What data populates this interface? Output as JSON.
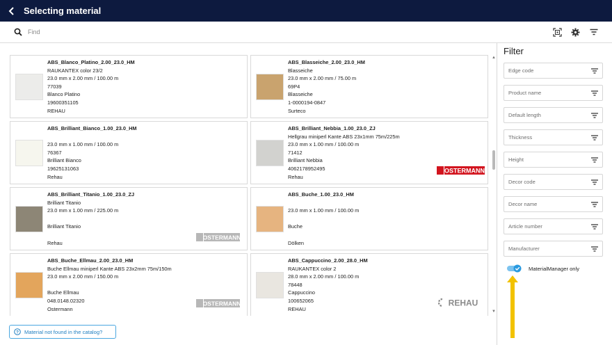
{
  "header": {
    "title": "Selecting material"
  },
  "search": {
    "placeholder": "Find"
  },
  "toolbar_icons": [
    "barcode-scan-icon",
    "gear-icon",
    "filter-lines-icon"
  ],
  "cards": [
    {
      "name": "ABS_Blanco_Platino_2.00_23.0_HM",
      "lines": [
        "RAUKANTEX color 23/2",
        "23.0 mm x 2.00 mm / 100.00 m",
        "77039",
        "Blanco Platino",
        "19600351105",
        "REHAU"
      ],
      "swatch": "#ececea",
      "brand": ""
    },
    {
      "name": "ABS_Blasseiche_2.00_23.0_HM",
      "lines": [
        "Blasseiche",
        "23.0 mm x 2.00 mm / 75.00 m",
        "69P4",
        "Blasseiche",
        "1-0000194-0847",
        "Surteco"
      ],
      "swatch": "#c9a36e",
      "brand": ""
    },
    {
      "name": "ABS_Brilliant_Bianco_1.00_23.0_HM",
      "lines": [
        "",
        "23.0 mm x 1.00 mm / 100.00 m",
        "76367",
        "Brilliant Bianco",
        "19625131063",
        "Rehau"
      ],
      "swatch": "#f6f6ee",
      "brand": ""
    },
    {
      "name": "ABS_Brilliant_Nebbia_1.00_23.0_ZJ",
      "lines": [
        "Hellgrau miniperl Kante ABS 23x1mm 75m/225m",
        "23.0 mm x 1.00 mm / 100.00 m",
        "71412",
        "Brilliant Nebbia",
        "4062178952495",
        "Rehau"
      ],
      "swatch": "#d2d2cf",
      "brand": "OSTERMANN"
    },
    {
      "name": "ABS_Brilliant_Titanio_1.00_23.0_ZJ",
      "lines": [
        "Brilliant Titanio",
        "23.0 mm x 1.00 mm / 225.00 m",
        "",
        "Brilliant Titanio",
        "",
        "Rehau"
      ],
      "swatch": "#8d8676",
      "brand": "OSTERMANN"
    },
    {
      "name": "ABS_Buche_1.00_23.0_HM",
      "lines": [
        "",
        "23.0 mm x 1.00 mm / 100.00 m",
        "",
        "Buche",
        "",
        "Dölken"
      ],
      "swatch": "#e6b480",
      "brand": ""
    },
    {
      "name": "ABS_Buche_Ellmau_2.00_23.0_HM",
      "lines": [
        "Buche Ellmau miniperl Kante ABS 23x2mm 75m/150m",
        "23.0 mm x 2.00 mm / 150.00 m",
        "",
        "Buche Ellmau",
        "048.0148.02320",
        "Ostermann"
      ],
      "swatch": "#e3a55c",
      "brand": "OSTERMANN"
    },
    {
      "name": "ABS_Cappuccino_2.00_28.0_HM",
      "lines": [
        "RAUKANTEX color 2",
        "28.0 mm x 2.00 mm / 100.00 m",
        "78448",
        "Cappuccino",
        "100652065",
        "REHAU"
      ],
      "swatch": "#e9e6e0",
      "brand": "REHAU"
    }
  ],
  "filter": {
    "title": "Filter",
    "fields": [
      "Edge code",
      "Product name",
      "Default length",
      "Thickness",
      "Height",
      "Decor code",
      "Decor name",
      "Article number",
      "Manufacturer"
    ],
    "toggle_label": "MaterialManager only",
    "toggle_on": true
  },
  "not_found_button": "Material not found in the catalog?",
  "colors": {
    "header_bg": "#0d1a3f",
    "accent": "#1f7fc1",
    "toggle": "#2a9ae0",
    "arrow": "#f2c200"
  }
}
